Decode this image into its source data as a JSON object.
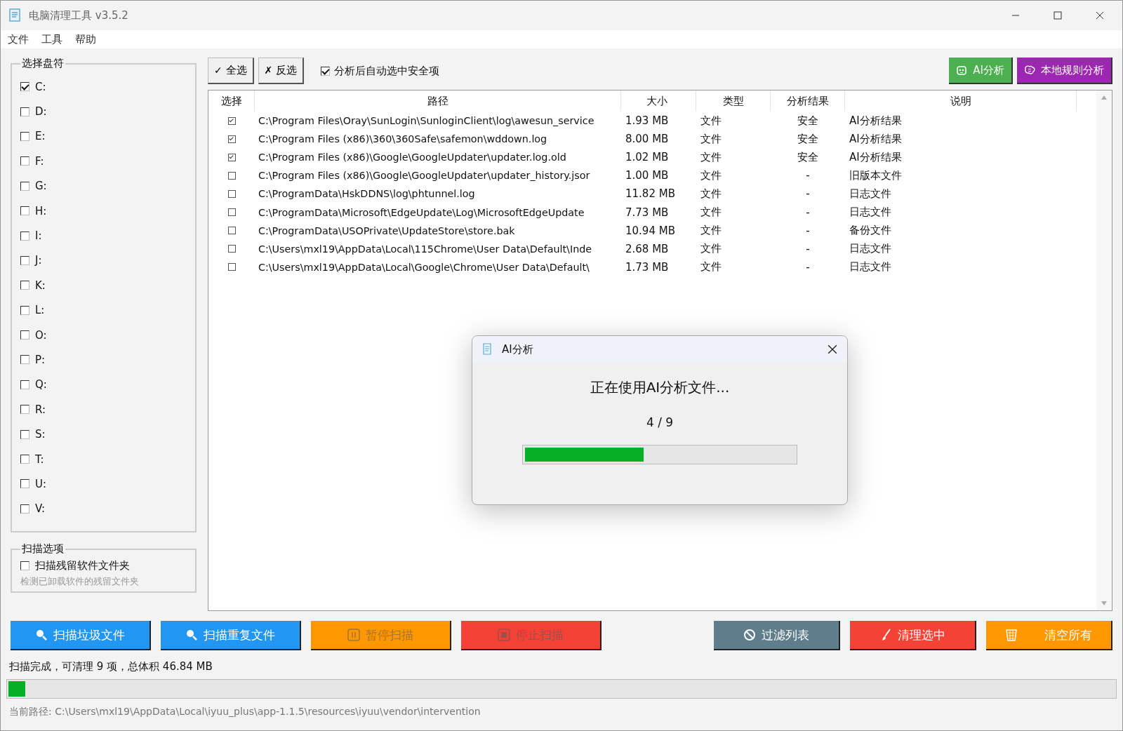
{
  "window": {
    "title": "电脑清理工具 v3.5.2"
  },
  "menu": [
    "文件",
    "工具",
    "帮助"
  ],
  "drives": {
    "title": "选择盘符",
    "items": [
      {
        "label": "C:",
        "checked": true
      },
      {
        "label": "D:",
        "checked": false
      },
      {
        "label": "E:",
        "checked": false
      },
      {
        "label": "F:",
        "checked": false
      },
      {
        "label": "G:",
        "checked": false
      },
      {
        "label": "H:",
        "checked": false
      },
      {
        "label": "I:",
        "checked": false
      },
      {
        "label": "J:",
        "checked": false
      },
      {
        "label": "K:",
        "checked": false
      },
      {
        "label": "L:",
        "checked": false
      },
      {
        "label": "O:",
        "checked": false
      },
      {
        "label": "P:",
        "checked": false
      },
      {
        "label": "Q:",
        "checked": false
      },
      {
        "label": "R:",
        "checked": false
      },
      {
        "label": "S:",
        "checked": false
      },
      {
        "label": "T:",
        "checked": false
      },
      {
        "label": "U:",
        "checked": false
      },
      {
        "label": "V:",
        "checked": false
      }
    ]
  },
  "scan_options": {
    "title": "扫描选项",
    "items": [
      {
        "label": "扫描残留软件文件夹",
        "checked": false,
        "hint": "检测已卸载软件的残留文件夹"
      }
    ]
  },
  "toolbar": {
    "select_all": {
      "icon": "✓",
      "label": "全选"
    },
    "invert": {
      "icon": "✗",
      "label": "反选"
    },
    "auto_select": {
      "label": "分析后自动选中安全项",
      "checked": true
    },
    "buttons": [
      {
        "label": "AI分析",
        "kind": "robot",
        "color": "#4caf50"
      },
      {
        "label": "本地规则分析",
        "kind": "brain",
        "color": "#9c27b0"
      }
    ]
  },
  "table": {
    "columns": [
      "选择",
      "路径",
      "大小",
      "类型",
      "分析结果",
      "说明"
    ],
    "rows": [
      {
        "checked": true,
        "path": "C:\\Program Files\\Oray\\SunLogin\\SunloginClient\\log\\awesun_service",
        "size": "1.93 MB",
        "type": "文件",
        "result": "安全",
        "note": "AI分析结果"
      },
      {
        "checked": true,
        "path": "C:\\Program Files (x86)\\360\\360Safe\\safemon\\wddown.log",
        "size": "8.00 MB",
        "type": "文件",
        "result": "安全",
        "note": "AI分析结果"
      },
      {
        "checked": true,
        "path": "C:\\Program Files (x86)\\Google\\GoogleUpdater\\updater.log.old",
        "size": "1.02 MB",
        "type": "文件",
        "result": "安全",
        "note": "AI分析结果"
      },
      {
        "checked": false,
        "path": "C:\\Program Files (x86)\\Google\\GoogleUpdater\\updater_history.jsor",
        "size": "1.00 MB",
        "type": "文件",
        "result": "-",
        "note": "旧版本文件"
      },
      {
        "checked": false,
        "path": "C:\\ProgramData\\HskDDNS\\log\\phtunnel.log",
        "size": "11.82 MB",
        "type": "文件",
        "result": "-",
        "note": "日志文件"
      },
      {
        "checked": false,
        "path": "C:\\ProgramData\\Microsoft\\EdgeUpdate\\Log\\MicrosoftEdgeUpdate",
        "size": "7.73 MB",
        "type": "文件",
        "result": "-",
        "note": "日志文件"
      },
      {
        "checked": false,
        "path": "C:\\ProgramData\\USOPrivate\\UpdateStore\\store.bak",
        "size": "10.94 MB",
        "type": "文件",
        "result": "-",
        "note": "备份文件"
      },
      {
        "checked": false,
        "path": "C:\\Users\\mxl19\\AppData\\Local\\115Chrome\\User Data\\Default\\Inde",
        "size": "2.68 MB",
        "type": "文件",
        "result": "-",
        "note": "日志文件"
      },
      {
        "checked": false,
        "path": "C:\\Users\\mxl19\\AppData\\Local\\Google\\Chrome\\User Data\\Default\\",
        "size": "1.73 MB",
        "type": "文件",
        "result": "-",
        "note": "日志文件"
      }
    ]
  },
  "actions_left": [
    {
      "label": "扫描垃圾文件",
      "kind": "search",
      "color": "#2196f3",
      "disabled": false
    },
    {
      "label": "扫描重复文件",
      "kind": "search",
      "color": "#2196f3",
      "disabled": false
    },
    {
      "label": "暂停扫描",
      "kind": "pause",
      "color": "#ff9800",
      "disabled": true
    },
    {
      "label": "停止扫描",
      "kind": "stop",
      "color": "#f44336",
      "disabled": true
    }
  ],
  "actions_right": [
    {
      "label": "过滤列表",
      "kind": "filter",
      "color": "#607d8b",
      "disabled": false
    },
    {
      "label": "清理选中",
      "kind": "brush",
      "color": "#f44336",
      "disabled": false
    },
    {
      "label": "清空所有",
      "kind": "trash",
      "color": "#ff9800",
      "disabled": false
    }
  ],
  "status": {
    "text": "扫描完成，可清理 9 项，总体积 46.84 MB",
    "level": 0.015,
    "current_path": "当前路径: C:\\Users\\mxl19\\AppData\\Local\\iyuu_plus\\app-1.1.5\\resources\\iyuu\\vendor\\intervention"
  },
  "dialog": {
    "title": "AI分析",
    "message": "正在使用AI分析文件...",
    "count": "4 / 9",
    "level": 0.44
  }
}
